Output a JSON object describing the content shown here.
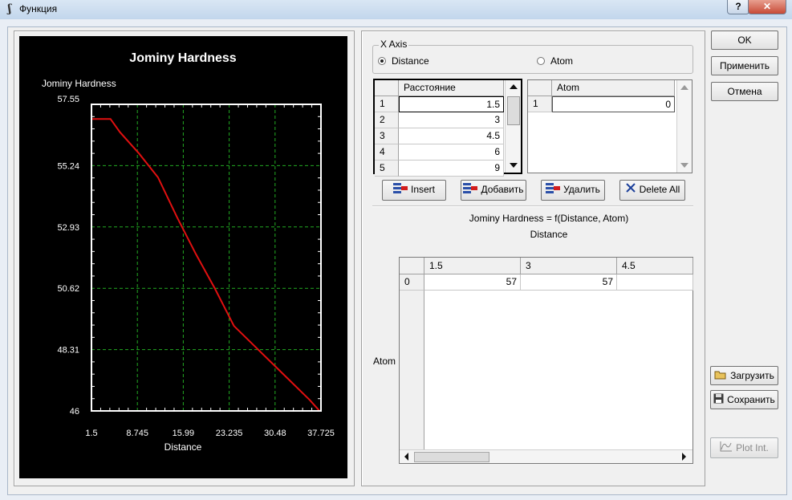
{
  "window": {
    "title": "Функция",
    "help": "?",
    "close": "✕"
  },
  "chart_data": {
    "type": "line",
    "title": "Jominy Hardness",
    "ylabel": "Jominy Hardness",
    "xlabel": "Distance",
    "xlim": [
      1.5,
      37.725
    ],
    "ylim": [
      46,
      57.55
    ],
    "x_ticks": [
      "1.5",
      "8.745",
      "15.99",
      "23.235",
      "30.48",
      "37.725"
    ],
    "y_ticks": [
      "57.55",
      "55.24",
      "52.93",
      "50.62",
      "48.31",
      "46"
    ],
    "grid": true,
    "colors": {
      "background": "#000000",
      "axes": "#ffffff",
      "grid": "#22aa22",
      "line": "#e01010"
    },
    "series": [
      {
        "x": [
          1.5,
          4.5,
          6,
          9,
          12,
          15,
          18,
          21,
          24,
          27,
          30,
          33,
          36,
          37.5
        ],
        "y": [
          57,
          57,
          56.5,
          55.7,
          54.8,
          53.3,
          51.9,
          50.6,
          49.2,
          48.5,
          47.8,
          47.1,
          46.4,
          46
        ]
      }
    ]
  },
  "xaxis": {
    "group_label": "X Axis",
    "option_distance": "Distance",
    "option_atom": "Atom",
    "selected": "Distance"
  },
  "table_distance": {
    "header": "Расстояние",
    "rows": [
      {
        "n": "1",
        "v": "1.5"
      },
      {
        "n": "2",
        "v": "3"
      },
      {
        "n": "3",
        "v": "4.5"
      },
      {
        "n": "4",
        "v": "6"
      },
      {
        "n": "5",
        "v": "9"
      }
    ]
  },
  "table_atom": {
    "header": "Atom",
    "rows": [
      {
        "n": "1",
        "v": "0"
      }
    ]
  },
  "toolbar": {
    "insert": "Insert",
    "add": "Добавить",
    "delete": "Удалить",
    "delete_all": "Delete All"
  },
  "function_label": "Jominy Hardness = f(Distance, Atom)",
  "matrix": {
    "col_axis_label": "Distance",
    "row_axis_label": "Atom",
    "col_headers": [
      "1.5",
      "3",
      "4.5"
    ],
    "row_headers": [
      "0"
    ],
    "values": [
      [
        "57",
        "57",
        ""
      ]
    ]
  },
  "buttons": {
    "ok": "OK",
    "apply": "Применить",
    "cancel": "Отмена",
    "load": "Загрузить",
    "save": "Сохранить",
    "plot": "Plot Int."
  }
}
